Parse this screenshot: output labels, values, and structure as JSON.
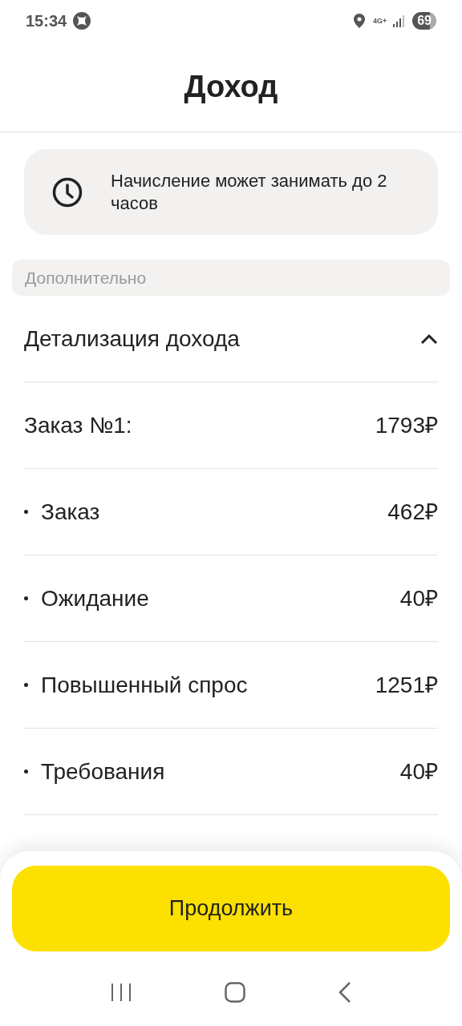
{
  "status_bar": {
    "time": "15:34",
    "network": "4G+",
    "battery": "69"
  },
  "title": "Доход",
  "notice": {
    "text": "Начисление может занимать до 2 часов"
  },
  "section": {
    "title": "Дополнительно"
  },
  "details": {
    "title": "Детализация дохода",
    "expanded": true,
    "rows": [
      {
        "kind": "order",
        "label": "Заказ №1:",
        "amount": "1793₽"
      },
      {
        "kind": "item",
        "label": "Заказ",
        "amount": "462₽"
      },
      {
        "kind": "item",
        "label": "Ожидание",
        "amount": "40₽"
      },
      {
        "kind": "item",
        "label": "Повышенный спрос",
        "amount": "1251₽"
      },
      {
        "kind": "item",
        "label": "Требования",
        "amount": "40₽"
      }
    ]
  },
  "continue_button": "Продолжить"
}
